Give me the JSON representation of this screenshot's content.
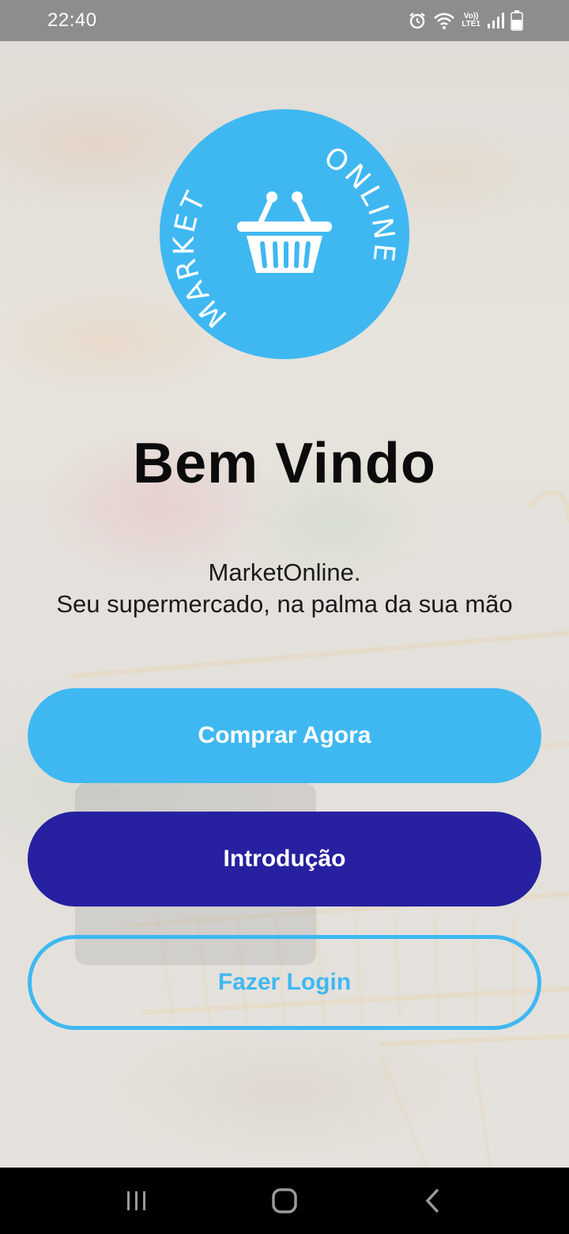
{
  "status_bar": {
    "time": "22:40",
    "lte_top": "Vo))",
    "lte_bottom": "LTE1",
    "icons": [
      "alarm-icon",
      "wifi-icon",
      "lte-icon",
      "signal-icon",
      "battery-icon"
    ]
  },
  "logo": {
    "text_left": "MARKET",
    "text_right": "ONLINE",
    "icon": "basket-icon",
    "color": "#3fb8f2"
  },
  "welcome": {
    "title": "Bem Vindo",
    "tagline_line1": "MarketOnline.",
    "tagline_line2": "Seu supermercado, na palma da sua mão"
  },
  "buttons": {
    "buy_now": "Comprar Agora",
    "intro": "Introdução",
    "login": "Fazer Login"
  },
  "colors": {
    "primary_light": "#3fb8f2",
    "primary_dark": "#2720a0"
  },
  "nav_bar": {
    "icons": [
      "recent-apps-icon",
      "home-icon",
      "back-icon"
    ]
  }
}
